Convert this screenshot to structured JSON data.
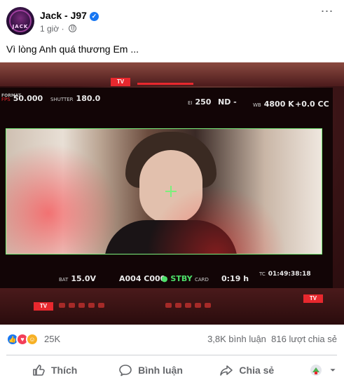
{
  "post": {
    "author": "Jack - J97",
    "avatar_text": "JACK",
    "time": "1 giờ",
    "caption": "Vì lòng Anh quá thương Em ...",
    "more_icon": "⋯"
  },
  "monitor": {
    "fps_label": "FPS",
    "fps_value": "50.000",
    "shutter_label": "SHUTTER",
    "shutter_value": "180.0",
    "ei_label": "EI",
    "ei_value": "250",
    "nd_value": "ND -",
    "wb_label": "WB",
    "wb_value": "4800 K",
    "cc_value": "+0.0 CC",
    "format_label": "FORMAT",
    "tv_top": "TV",
    "bat_label": "BAT",
    "bat_value": "15.0V",
    "clip_value": "A004 C000",
    "stby_value": "● STBY",
    "card_label": "CARD",
    "card_value": "0:19 h",
    "tc_label": "TC",
    "tc_value": "01:49:38:18",
    "tv_left": "TV",
    "tv_right": "TV"
  },
  "stats": {
    "reactions_count": "25K",
    "comments": "3,8K bình luận",
    "shares": "816 lượt chia sẻ"
  },
  "actions": {
    "like_label": "Thích",
    "comment_label": "Bình luận",
    "share_label": "Chia sẻ"
  }
}
